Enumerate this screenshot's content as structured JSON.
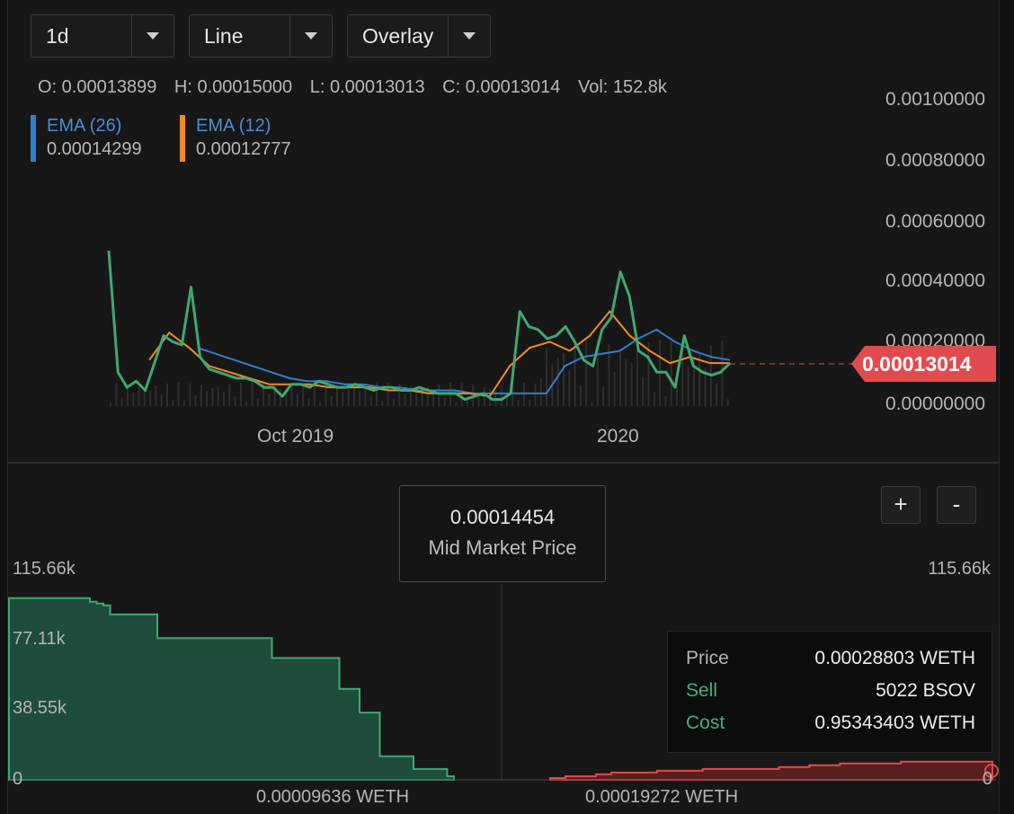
{
  "toolbar": {
    "interval": "1d",
    "chart_style": "Line",
    "mode": "Overlay"
  },
  "ohlc": {
    "open": "O: 0.00013899",
    "high": "H: 0.00015000",
    "low": "L: 0.00013013",
    "close": "C: 0.00013014",
    "volume": "Vol: 152.8k"
  },
  "indicators": [
    {
      "name": "EMA (26)",
      "value": "0.00014299",
      "color": "#2f7fd0"
    },
    {
      "name": "EMA (12)",
      "value": "0.00012777",
      "color": "#f08a24"
    }
  ],
  "current_price": "0.00013014",
  "mid_market": {
    "price": "0.00014454",
    "label": "Mid Market Price"
  },
  "zoom": {
    "in": "+",
    "out": "-"
  },
  "tooltip": {
    "price_label": "Price",
    "price_value": "0.00028803 WETH",
    "sell_label": "Sell",
    "sell_value": "5022 BSOV",
    "cost_label": "Cost",
    "cost_value": "0.95343403 WETH"
  },
  "colors": {
    "price_line": "#3fa873",
    "ema26": "#2f7fd0",
    "ema12": "#f08a24",
    "bid": "#1e5a45",
    "ask": "#e04a4a",
    "tag": "#e14b50"
  },
  "chart_data": [
    {
      "type": "line",
      "y_ticks": [
        "0.00100000",
        "0.00080000",
        "0.00060000",
        "0.00040000",
        "0.00020000",
        "0.00000000"
      ],
      "ylim": [
        0,
        0.001
      ],
      "x_ticks": [
        "Oct 2019",
        "2020"
      ],
      "series": [
        {
          "name": "",
          "values": [
            0.0005,
            0.0001,
            5e-05,
            7e-05,
            4e-05,
            0.00013,
            0.00022,
            0.0002,
            0.00019,
            0.00038,
            0.00015,
            0.00011,
            0.0001,
            9e-05,
            8e-05,
            8e-05,
            7e-05,
            5e-05,
            5e-05,
            2e-05,
            6e-05,
            6e-05,
            5e-05,
            7e-05,
            6e-05,
            5e-05,
            5e-05,
            6e-05,
            5e-05,
            4e-05,
            5e-05,
            5e-05,
            4e-05,
            4e-05,
            5e-05,
            4e-05,
            3e-05,
            3e-05,
            3e-05,
            1e-05,
            2e-05,
            3e-05,
            1e-05,
            1e-05,
            3e-05,
            0.0003,
            0.00025,
            0.00024,
            0.00021,
            0.00022,
            0.00025,
            0.0002,
            0.00014,
            0.00012,
            0.00024,
            0.00028,
            0.00043,
            0.00035,
            0.00017,
            0.00015,
            0.0001,
            0.0001,
            5e-05,
            0.00022,
            0.00012,
            0.0001,
            9e-05,
            0.0001,
            0.00013
          ]
        },
        {
          "name": "EMA (26)",
          "values": [
            0.00018,
            0.00016,
            0.00014,
            0.00012,
            0.0001,
            8e-05,
            7e-05,
            7e-05,
            6e-05,
            6e-05,
            5e-05,
            5e-05,
            4e-05,
            4e-05,
            4e-05,
            3e-05,
            3e-05,
            3e-05,
            3e-05,
            3e-05,
            0.00012,
            0.00015,
            0.00016,
            0.00017,
            0.00021,
            0.00024,
            0.0002,
            0.00017,
            0.00015,
            0.00014
          ]
        },
        {
          "name": "EMA (12)",
          "values": [
            0.00014,
            0.00023,
            0.00018,
            0.00012,
            0.0001,
            8e-05,
            6e-05,
            6e-05,
            6e-05,
            5e-05,
            5e-05,
            5e-05,
            4e-05,
            4e-05,
            3e-05,
            3e-05,
            3e-05,
            2e-05,
            0.00012,
            0.00018,
            0.0002,
            0.00017,
            0.00022,
            0.0003,
            0.00022,
            0.00017,
            0.00013,
            0.00015,
            0.00013,
            0.00013
          ]
        }
      ]
    },
    {
      "type": "area",
      "y_ticks": [
        "115.66k",
        "77.11k",
        "38.55k",
        "0"
      ],
      "ylim": [
        0,
        115.66
      ],
      "x_ticks": [
        "0.00009636 WETH",
        "0.00019272 WETH"
      ],
      "series": [
        {
          "name": "",
          "values": [
            100,
            100,
            100,
            100,
            100,
            100,
            100,
            100,
            100,
            100,
            100,
            100,
            98,
            97,
            96,
            91,
            91,
            91,
            91,
            91,
            91,
            91,
            78,
            78,
            78,
            78,
            78,
            78,
            78,
            78,
            78,
            78,
            78,
            78,
            78,
            78,
            78,
            78,
            78,
            67,
            67,
            67,
            67,
            67,
            67,
            67,
            67,
            67,
            67,
            50,
            50,
            50,
            37,
            37,
            37,
            13,
            13,
            13,
            13,
            13,
            6,
            6,
            6,
            6,
            6,
            2
          ]
        },
        {
          "name": "",
          "values": [
            1,
            2,
            2,
            3,
            4,
            4,
            4,
            5,
            5,
            5,
            6,
            6,
            6,
            6,
            6,
            7,
            7,
            8,
            8,
            9,
            9,
            9,
            9,
            10,
            10,
            10,
            10,
            10,
            10
          ]
        }
      ]
    }
  ]
}
